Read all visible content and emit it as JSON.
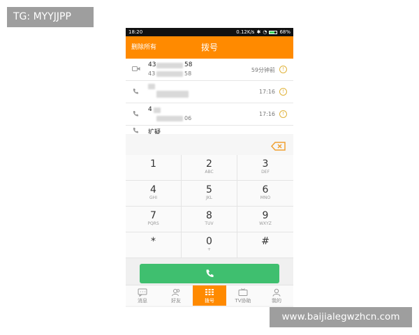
{
  "overlay": {
    "top_left_label": "TG: MYYJJPP",
    "bottom_right_watermark": "www.baijialegwzhcn.com"
  },
  "status_bar": {
    "time": "18:20",
    "net_speed": "0.12K/s",
    "battery_pct": "68%",
    "battery_level": 0.68,
    "battery_color": "#3fd35f"
  },
  "header": {
    "left_action": "删除所有",
    "title": "拨号",
    "color": "#ff8a00"
  },
  "call_log": [
    {
      "icon": "video-call-icon",
      "name": "43",
      "name_suffix": "58",
      "number": "43",
      "number_suffix": "58",
      "time": "59分钟前"
    },
    {
      "icon": "phone-icon",
      "name": "",
      "name_suffix": "",
      "number": "",
      "number_suffix": "",
      "time": "17:16"
    },
    {
      "icon": "phone-icon",
      "name": "4",
      "name_suffix": "",
      "number": "",
      "number_suffix": "06",
      "time": "17:16"
    },
    {
      "icon": "phone-icon",
      "name": "扩疑",
      "name_suffix": "",
      "number": "",
      "number_suffix": "",
      "time": ""
    }
  ],
  "keypad": [
    {
      "digit": "1",
      "letters": ""
    },
    {
      "digit": "2",
      "letters": "ABC"
    },
    {
      "digit": "3",
      "letters": "DEF"
    },
    {
      "digit": "4",
      "letters": "GHI"
    },
    {
      "digit": "5",
      "letters": "JKL"
    },
    {
      "digit": "6",
      "letters": "MNO"
    },
    {
      "digit": "7",
      "letters": "PQRS"
    },
    {
      "digit": "8",
      "letters": "TUV"
    },
    {
      "digit": "9",
      "letters": "WXYZ"
    },
    {
      "digit": "*",
      "letters": ""
    },
    {
      "digit": "0",
      "letters": "+"
    },
    {
      "digit": "#",
      "letters": ""
    }
  ],
  "call_button": {
    "icon": "phone-handset-icon",
    "color": "#3fbf6f"
  },
  "tabs": [
    {
      "label": "消息",
      "icon": "message-icon",
      "active": false
    },
    {
      "label": "好友",
      "icon": "friends-icon",
      "active": false
    },
    {
      "label": "拨号",
      "icon": "dialpad-icon",
      "active": true
    },
    {
      "label": "TV协助",
      "icon": "tv-icon",
      "active": false
    },
    {
      "label": "我的",
      "icon": "profile-icon",
      "active": false
    }
  ]
}
